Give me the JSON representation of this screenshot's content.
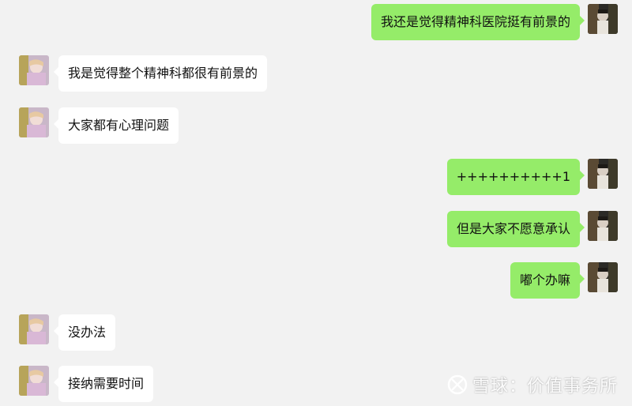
{
  "messages": [
    {
      "side": "right",
      "text": "我还是觉得精神科医院挺有前景的"
    },
    {
      "side": "left",
      "text": "我是觉得整个精神科都很有前景的"
    },
    {
      "side": "left",
      "text": "大家都有心理问题"
    },
    {
      "side": "right",
      "text": "++++++++++1"
    },
    {
      "side": "right",
      "text": "但是大家不愿意承认"
    },
    {
      "side": "right",
      "text": "嘟个办嘛"
    },
    {
      "side": "left",
      "text": "没办法"
    },
    {
      "side": "left",
      "text": "接纳需要时间"
    }
  ],
  "watermark": {
    "text": "雪球：价值事务所"
  },
  "colors": {
    "background": "#f2f2f2",
    "bubble_self": "#95ec69",
    "bubble_other": "#ffffff",
    "text": "#111111"
  },
  "icons": {
    "avatar_other": "avatar-other-icon",
    "avatar_self": "avatar-self-icon",
    "watermark_logo": "xueqiu-logo-icon"
  }
}
